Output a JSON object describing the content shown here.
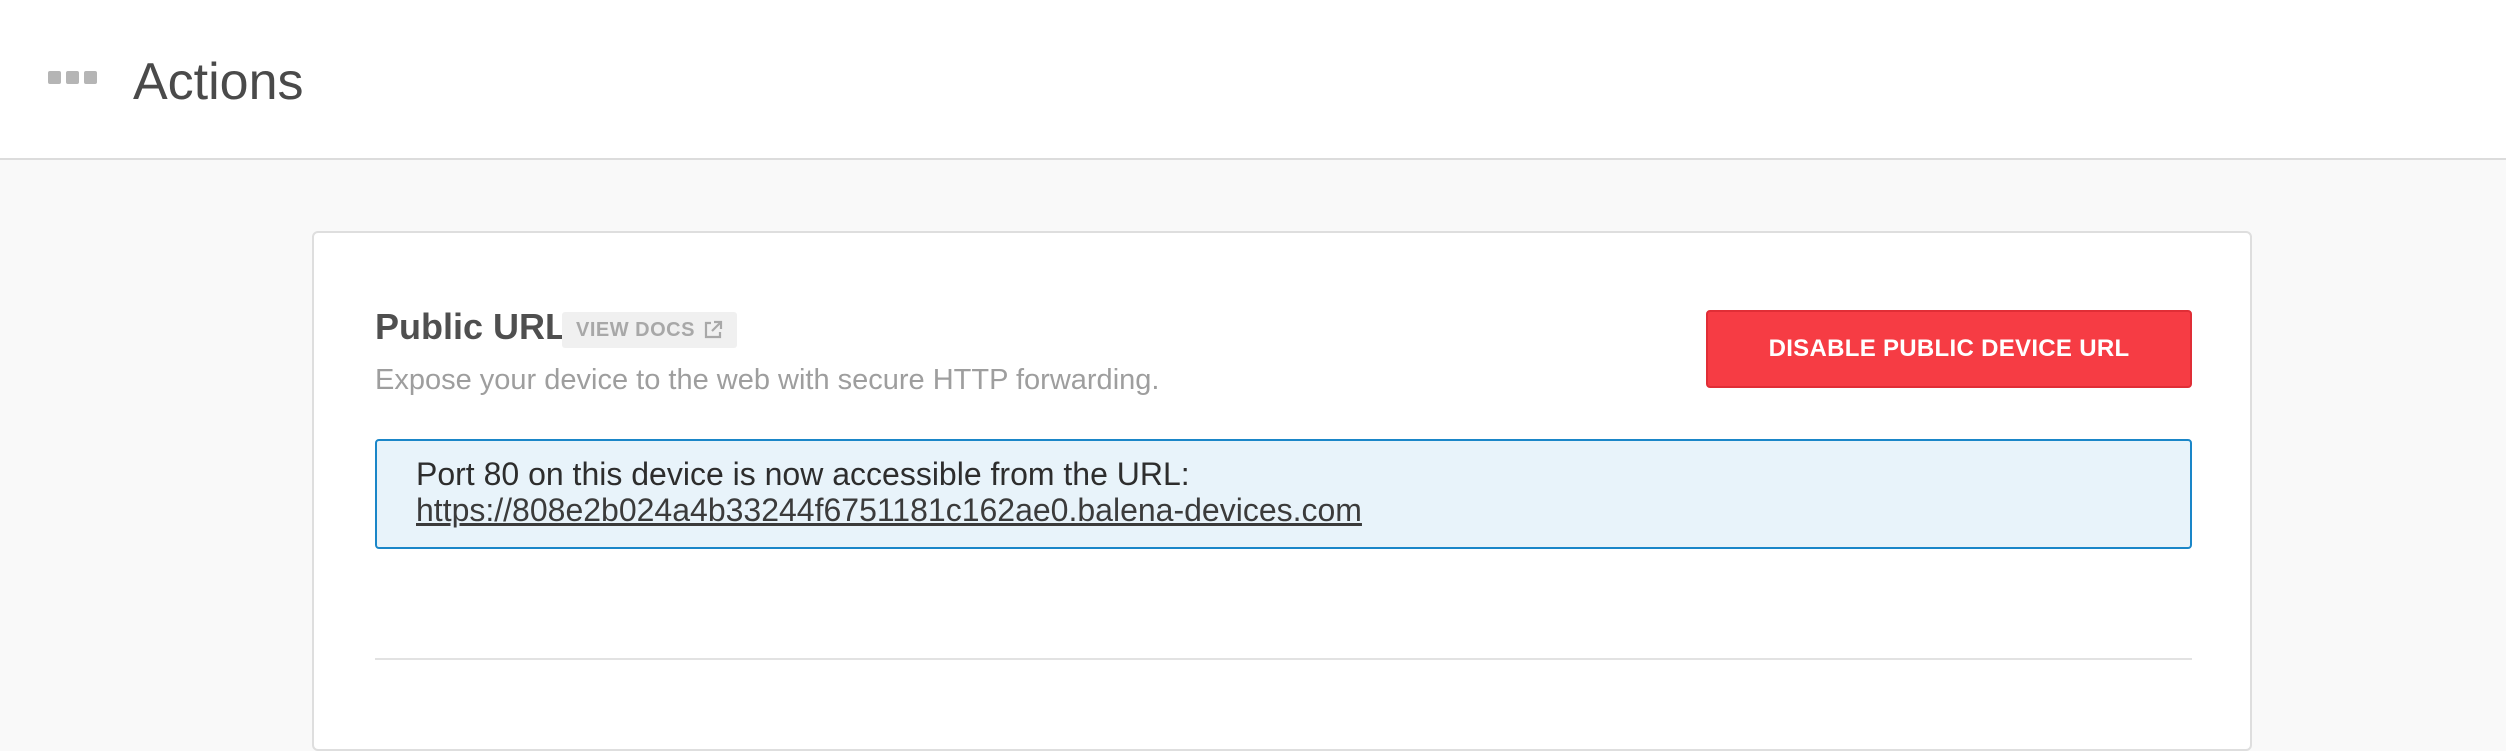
{
  "header": {
    "icon": "three-dots-menu-icon",
    "title": "Actions"
  },
  "public_url": {
    "title": "Public URL",
    "docs_label": "VIEW DOCS",
    "docs_icon": "external-link-icon",
    "description": "Expose your device to the web with secure HTTP forwarding.",
    "button_label": "DISABLE PUBLIC DEVICE URL",
    "info_text": "Port 80 on this device is now accessible from the URL:",
    "url": "https://808e2b024a4b33244f6751181c162ae0.balena-devices.com"
  },
  "colors": {
    "danger": "#f63c44",
    "info_bg": "#e8f3fa",
    "info_border": "#1a86c8"
  }
}
